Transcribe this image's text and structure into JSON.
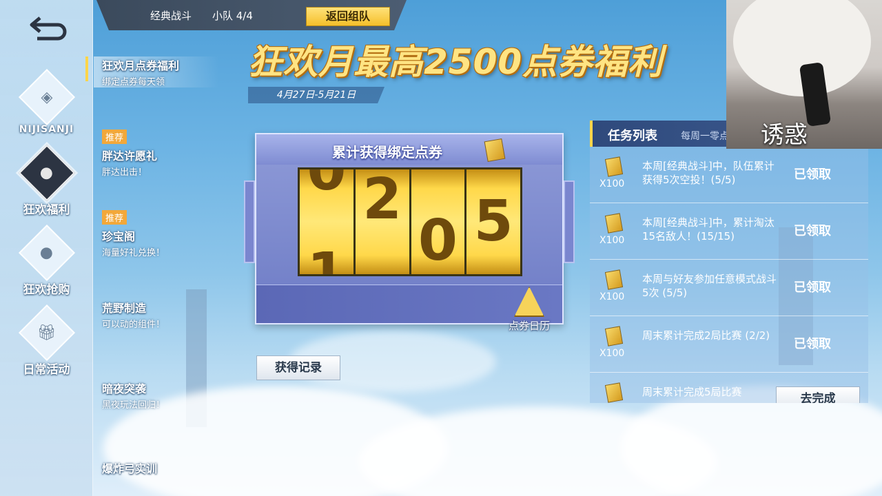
{
  "topbar": {
    "mode": "经典战斗",
    "team": "小队 4/4",
    "return_label": "返回组队"
  },
  "rail": {
    "items": [
      {
        "label": "NIJISANJI",
        "icon": "nijisanji-logo-icon"
      },
      {
        "label": "狂欢福利",
        "icon": "balloon-icon",
        "active": true
      },
      {
        "label": "狂欢抢购",
        "icon": "balloon-icon"
      },
      {
        "label": "日常活动",
        "icon": "gift-icon"
      }
    ]
  },
  "menu": {
    "items": [
      {
        "title": "狂欢月点券福利",
        "subtitle": "绑定点券每天领",
        "tag": "",
        "active": true
      },
      {
        "title": "胖达许愿礼",
        "subtitle": "胖达出击！",
        "tag": "推荐"
      },
      {
        "title": "珍宝阁",
        "subtitle": "海量好礼兑换！",
        "tag": "推荐"
      },
      {
        "title": "荒野制造",
        "subtitle": "可以动的组件！",
        "tag": ""
      },
      {
        "title": "暗夜突袭",
        "subtitle": "黑夜玩法回归！",
        "tag": ""
      },
      {
        "title": "爆炸弓实训",
        "subtitle": "",
        "tag": ""
      }
    ]
  },
  "banner": {
    "title": "狂欢月最高2500点券福利",
    "date_range": "4月27日-5月21日"
  },
  "counter": {
    "title": "累计获得绑定点券",
    "digits": [
      {
        "upper": "0",
        "lower": "1"
      },
      {
        "upper": "2",
        "lower": ""
      },
      {
        "upper": "",
        "lower": "0"
      },
      {
        "upper": "5",
        "lower": ""
      }
    ],
    "calendar_label": "点券日历",
    "record_label": "获得记录"
  },
  "tasks": {
    "title": "任务列表",
    "hint": "每周一零点",
    "items": [
      {
        "reward": "X100",
        "desc": "本周[经典战斗]中，队伍累计获得5次空投！(5/5)",
        "status": "已领取"
      },
      {
        "reward": "X100",
        "desc": "本周[经典战斗]中，累计淘汰15名敌人！(15/15)",
        "status": "已领取"
      },
      {
        "reward": "X100",
        "desc": "本周与好友参加任意模式战斗5次 (5/5)",
        "status": "已领取"
      },
      {
        "reward": "X100",
        "desc": "周末累计完成2局比赛 (2/2)",
        "status": "已领取"
      },
      {
        "reward": "",
        "desc": "周末累计完成5局比赛",
        "status": "去完成"
      }
    ]
  },
  "webcam": {
    "caption": "诱惑"
  },
  "colors": {
    "accent_gold": "#ffd84a",
    "banner_text": "#ffe483",
    "tag_orange": "#f2a83a",
    "panel_purple": "#7f8cd2"
  }
}
